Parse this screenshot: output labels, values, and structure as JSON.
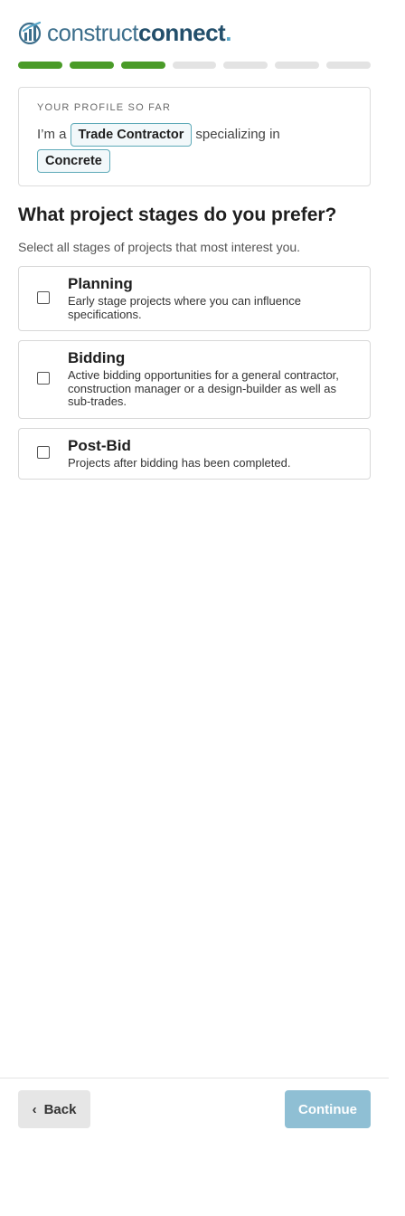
{
  "brand": {
    "logo_mark": "constructconnect-logo-icon",
    "name_part1": "construct",
    "name_part2": "connect",
    "name_dot": ".",
    "colors": {
      "primary": "#234f6b",
      "accent": "#58a6c8",
      "progress": "#4a9b28"
    }
  },
  "progress": {
    "total_steps": 7,
    "completed_steps": 3
  },
  "profile": {
    "kicker": "YOUR PROFILE SO FAR",
    "prefix": "I’m a",
    "role": "Trade Contractor",
    "connector": "specializing in",
    "specialty": "Concrete"
  },
  "question": {
    "title": "What project stages do you prefer?",
    "subtitle": "Select all stages of projects that most interest you."
  },
  "options": [
    {
      "title": "Planning",
      "description": "Early stage projects where you can influence specifications.",
      "checked": false
    },
    {
      "title": "Bidding",
      "description": "Active bidding opportunities for a general contractor, construction manager or a design-builder as well as sub-trades.",
      "checked": false
    },
    {
      "title": "Post-Bid",
      "description": "Projects after bidding has been completed.",
      "checked": false
    }
  ],
  "footer": {
    "back_icon": "chevron-left-icon",
    "back_label": "Back",
    "continue_label": "Continue",
    "continue_enabled": false
  }
}
